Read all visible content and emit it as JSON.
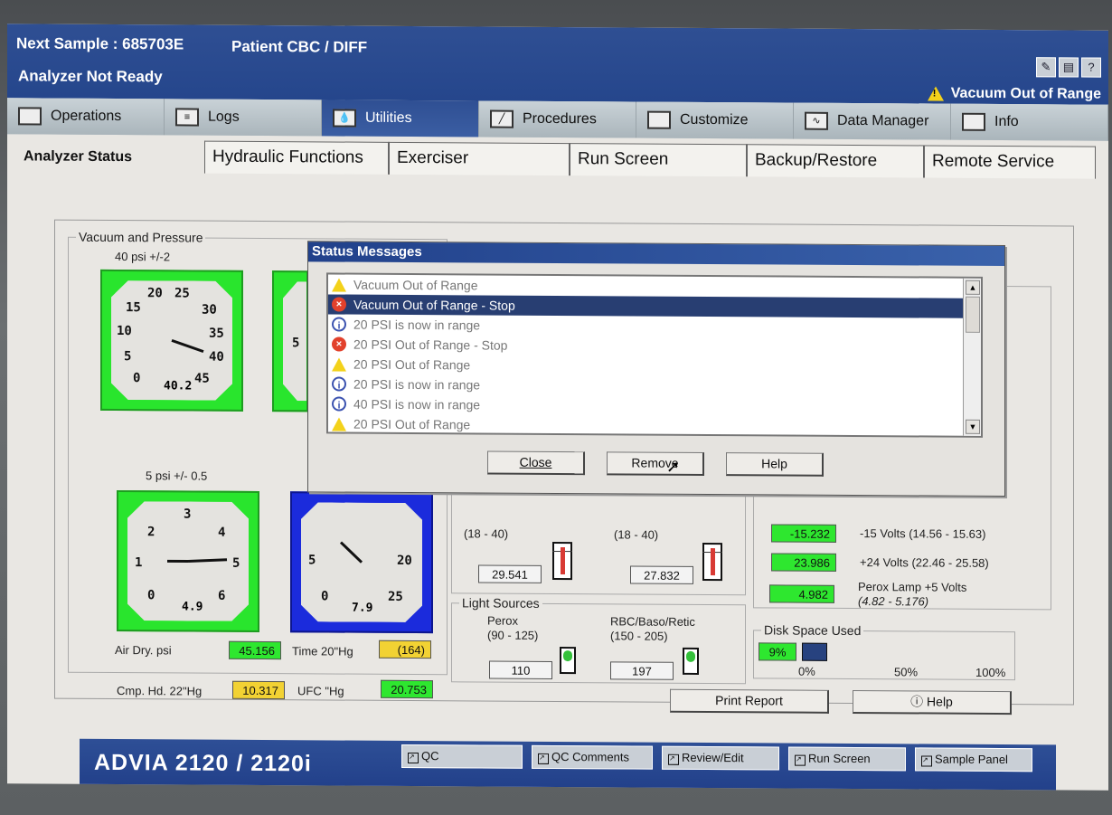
{
  "header": {
    "next_sample": "Next Sample : 685703E",
    "patient": "Patient CBC / DIFF",
    "status": "Analyzer Not Ready",
    "warning": "Vacuum Out of Range"
  },
  "nav": [
    {
      "label": "Operations"
    },
    {
      "label": "Logs"
    },
    {
      "label": "Utilities",
      "active": true
    },
    {
      "label": "Procedures"
    },
    {
      "label": "Customize"
    },
    {
      "label": "Data Manager"
    },
    {
      "label": "Info"
    }
  ],
  "tabs": [
    "Analyzer Status",
    "Hydraulic Functions",
    "Exerciser",
    "Run Screen",
    "Backup/Restore",
    "Remote Service"
  ],
  "vacuum": {
    "legend": "Vacuum and Pressure",
    "g1": {
      "spec": "40 psi +/-2",
      "reading": "40.2",
      "ticks": [
        "20",
        "25",
        "15",
        "30",
        "10",
        "35",
        "5",
        "40",
        "0",
        "45"
      ],
      "value": 40.2
    },
    "g2": {
      "spec": "5 psi +/- 0.5",
      "reading": "4.9",
      "ticks": [
        "3",
        "2",
        "4",
        "1",
        "5",
        "0",
        "6"
      ],
      "value": 4.9
    },
    "g3": {
      "reading": "7.9",
      "ticks": [
        "5",
        "20",
        "0",
        "25"
      ],
      "value": 7.9
    },
    "g4": {
      "ticks": [
        "5"
      ]
    },
    "air_dry_label": "Air Dry. psi",
    "air_dry": "45.156",
    "time_label": "Time 20\"Hg",
    "time": "(164)",
    "cmp_label": "Cmp. Hd. 22\"Hg",
    "cmp": "10.317",
    "ufc_label": "UFC \"Hg",
    "ufc": "20.753"
  },
  "temps": {
    "range1": "(18 - 40)",
    "val1": "29.541",
    "range2": "(18 - 40)",
    "val2": "27.832"
  },
  "light": {
    "legend": "Light Sources",
    "perox": "Perox",
    "perox_range": "(90 - 125)",
    "perox_val": "110",
    "rbc": "RBC/Baso/Retic",
    "rbc_range": "(150 - 205)",
    "rbc_val": "197"
  },
  "volts": [
    {
      "value": "-15.232",
      "label": "-15 Volts (14.56 - 15.63)"
    },
    {
      "value": "23.986",
      "label": "+24 Volts (22.46 - 25.58)"
    },
    {
      "value": "4.982",
      "label": "Perox Lamp +5 Volts",
      "range": "(4.82 - 5.176)"
    }
  ],
  "disk": {
    "legend": "Disk Space Used",
    "value": "9%",
    "fraction": 0.09,
    "ticks": [
      "0%",
      "50%",
      "100%"
    ]
  },
  "buttons": {
    "print": "Print Report",
    "help": "Help"
  },
  "dialog": {
    "title": "Status Messages",
    "items": [
      {
        "icon": "warning",
        "text": "Vacuum Out of Range"
      },
      {
        "icon": "error",
        "text": "Vacuum Out of Range - Stop",
        "selected": true
      },
      {
        "icon": "info",
        "text": "20 PSI is now in range"
      },
      {
        "icon": "error",
        "text": "20 PSI Out of Range - Stop"
      },
      {
        "icon": "warning",
        "text": "20 PSI Out of Range"
      },
      {
        "icon": "info",
        "text": "20 PSI is now in range"
      },
      {
        "icon": "info",
        "text": "40 PSI is now in range"
      },
      {
        "icon": "warning",
        "text": "20 PSI Out of Range"
      }
    ],
    "close": "Close",
    "remove": "Remove",
    "help": "Help"
  },
  "taskbar": {
    "brand": "ADVIA 2120 / 2120i",
    "buttons": [
      "QC",
      "QC Comments",
      "Review/Edit",
      "Run Screen",
      "Sample Panel"
    ]
  }
}
